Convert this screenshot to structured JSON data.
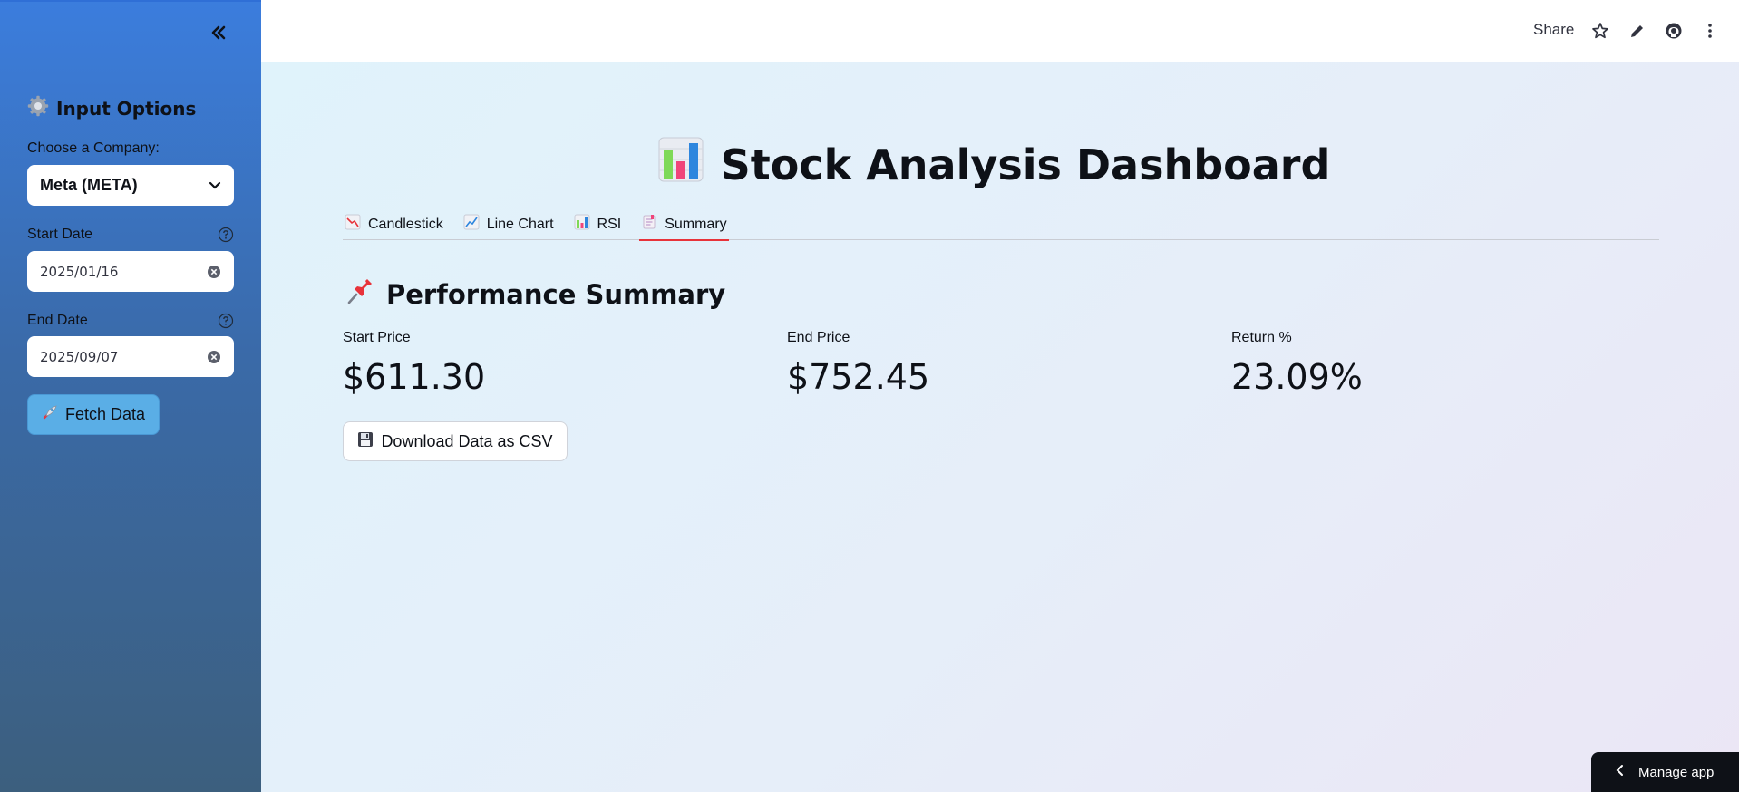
{
  "sidebar": {
    "title": "Input Options",
    "company_label": "Choose a Company:",
    "company_value": "Meta (META)",
    "start_label": "Start Date",
    "start_value": "2025/01/16",
    "end_label": "End Date",
    "end_value": "2025/09/07",
    "fetch_label": "Fetch Data"
  },
  "header": {
    "share_label": "Share"
  },
  "main": {
    "title": "Stock Analysis Dashboard",
    "tabs": [
      {
        "label": "Candlestick"
      },
      {
        "label": "Line Chart"
      },
      {
        "label": "RSI"
      },
      {
        "label": "Summary"
      }
    ],
    "active_tab": "Summary",
    "section_title": "Performance Summary",
    "metrics": [
      {
        "label": "Start Price",
        "value": "$611.30"
      },
      {
        "label": "End Price",
        "value": "$752.45"
      },
      {
        "label": "Return %",
        "value": "23.09%"
      }
    ],
    "download_label": "Download Data as CSV"
  },
  "footer": {
    "manage_label": "Manage app"
  },
  "colors": {
    "tab_accent": "#e8333a",
    "fetch_button": "#5aaee6",
    "sidebar_top": "#3b7ddd",
    "sidebar_bottom": "#3c5f7e"
  }
}
